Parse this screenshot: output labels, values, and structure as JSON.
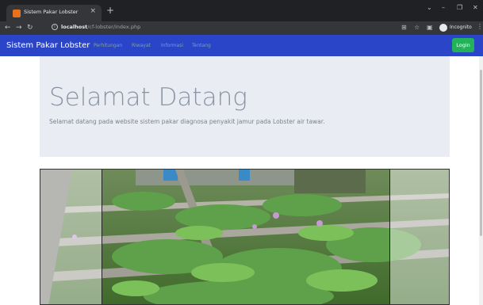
{
  "browser": {
    "tab_title": "Sistem Pakar Lobster",
    "tab_close": "×",
    "new_tab": "+",
    "url_host": "localhost",
    "url_path": "/cf-lobster/index.php",
    "profile_label": "Incognito",
    "icons": [
      "back-icon",
      "forward-icon",
      "reload-icon",
      "info-icon",
      "translate-icon",
      "star-icon",
      "sidepanel-icon",
      "incognito-icon",
      "menu-icon"
    ]
  },
  "navbar": {
    "brand": "Sistem Pakar Lobster",
    "links": [
      "Perhitungan",
      "Riwayat",
      "Informasi",
      "Tentang"
    ],
    "login_label": "Login",
    "colors": {
      "navbar": "#2b45c8",
      "login": "#22b35a"
    }
  },
  "jumbotron": {
    "title": "Selamat Datang",
    "text": "Selamat datang pada website sistem pakar diagnosa penyakit jamur pada Lobster air tawar."
  },
  "carousel": {
    "image": "water-hyacinth-ponds-photo"
  }
}
